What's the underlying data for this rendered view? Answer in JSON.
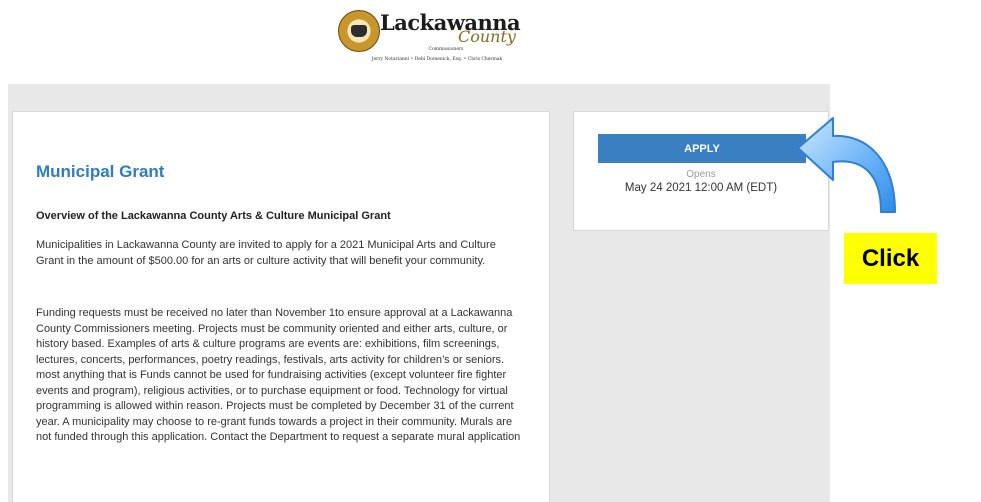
{
  "header": {
    "logo": {
      "name": "Lackawanna",
      "script": "County",
      "subtitle": "Commissioners",
      "officials": "Jerry Notarianni  •  Debi Domenick, Esq.  •  Chris Chermak"
    }
  },
  "grant": {
    "title": "Municipal Grant",
    "overview_heading": "Overview of the Lackawanna County Arts & Culture Municipal Grant",
    "paragraph1": "Municipalities in Lackawanna County are invited to apply for a 2021 Municipal Arts and Culture Grant in the amount of $500.00 for an arts or culture activity that will benefit your community.",
    "paragraph2": "Funding requests must be received no later than November 1to ensure approval at a Lackawanna County Commissioners meeting. Projects must be community oriented and either arts, culture, or history based. Examples of arts & culture programs are events are: exhibitions, film screenings, lectures, concerts, performances, poetry readings, festivals, arts activity for children’s or seniors. most anything that is Funds cannot be used for fundraising activities (except volunteer fire fighter events and program), religious activities, or to purchase equipment or food. Technology for virtual programming is allowed within reason. Projects must be completed by December 31 of the current year. A municipality may choose to re-grant funds towards a project in their community. Murals are not funded through this application. Contact the Department to request a separate mural application"
  },
  "apply_panel": {
    "button_label": "APPLY",
    "opens_label": "Opens",
    "opens_date": "May 24 2021 12:00 AM (EDT)"
  },
  "annotation": {
    "callout_text": "Click",
    "arrow_color": "#3a97f0",
    "callout_color": "#ffff00"
  }
}
